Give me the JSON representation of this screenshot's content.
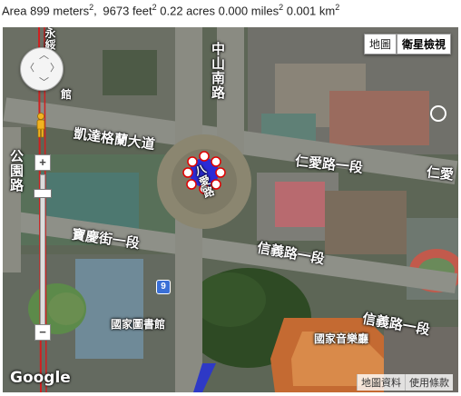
{
  "area": {
    "prefix": "Area",
    "meters": "899 meters",
    "feet": "9673 feet",
    "acres": "0.22 acres",
    "miles": "0.000 miles",
    "km": "0.001 km",
    "exp": "2"
  },
  "map_type": {
    "map": "地圖",
    "satellite": "衛星檢視"
  },
  "controls": {
    "zoom_in": "+",
    "zoom_out": "−"
  },
  "labels": {
    "zhongshan_s": "中山南路",
    "ketagalan": "凱達格蘭大道",
    "park_road": "公園路",
    "ren_ai": "仁愛路一段",
    "ren_ai_right": "仁愛",
    "aiguo": "八愛路",
    "baoqing": "寶慶街一段",
    "xinyi": "信義路一段",
    "xinyi_right": "信義路一段",
    "library": "國家圖書館",
    "concert_hall": "國家音樂廳",
    "top_left": "永綏",
    "guanguan": "館",
    "shield": "9"
  },
  "logo": "Google",
  "footer": {
    "map_data": "地圖資料",
    "terms": "使用條款"
  },
  "colors": {
    "polygon_fill": "#2b2bd6",
    "vertex_stroke": "#e00000"
  }
}
